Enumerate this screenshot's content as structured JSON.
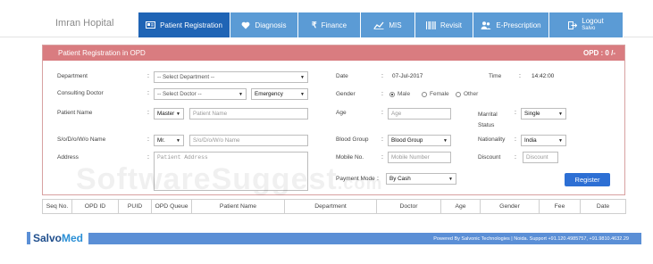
{
  "brand": "Imran Hopital",
  "nav": {
    "items": [
      {
        "label": "Patient Registration",
        "icon": "id-card-icon",
        "active": true
      },
      {
        "label": "Diagnosis",
        "icon": "heart-icon",
        "active": false
      },
      {
        "label": "Finance",
        "icon": "rupee-icon",
        "active": false
      },
      {
        "label": "MIS",
        "icon": "line-chart-icon",
        "active": false
      },
      {
        "label": "Revisit",
        "icon": "barcode-icon",
        "active": false
      },
      {
        "label": "E-Prescription",
        "icon": "users-icon",
        "active": false
      }
    ],
    "logout": {
      "label": "Logout",
      "user": "Salvo"
    }
  },
  "panel": {
    "title": "Patient Registration in OPD",
    "opd": "OPD : 0 /-"
  },
  "form": {
    "department": {
      "label": "Department",
      "value": "-- Select Department --"
    },
    "date": {
      "label": "Date",
      "value": "07-Jul-2017"
    },
    "time": {
      "label": "Time",
      "value": "14:42:00"
    },
    "consulting_doctor": {
      "label": "Consulting Doctor",
      "value": "-- Select Doctor --",
      "type_value": "Emergency"
    },
    "gender": {
      "label": "Gender",
      "options": [
        "Male",
        "Female",
        "Other"
      ],
      "selected": "Male"
    },
    "patient_name": {
      "label": "Patient Name",
      "title": "Master",
      "placeholder": "Patient Name"
    },
    "age": {
      "label": "Age",
      "placeholder": "Age"
    },
    "marital_status": {
      "label": "Marrital Status",
      "value": "Single"
    },
    "relation": {
      "label": "S/o/D/o/W/o Name",
      "title": "Mr.",
      "placeholder": "S/o/D/o/W/o Name"
    },
    "blood_group": {
      "label": "Blood Group",
      "value": "Blood Group"
    },
    "nationality": {
      "label": "Nationality",
      "value": "India"
    },
    "address": {
      "label": "Address",
      "placeholder": "Patient Address"
    },
    "mobile": {
      "label": "Mobile No.",
      "placeholder": "Mobile Number"
    },
    "discount": {
      "label": "Discount",
      "placeholder": "Discount"
    },
    "payment_mode": {
      "label": "Payment Mode",
      "value": "By Cash"
    },
    "register_label": "Register"
  },
  "table": {
    "columns": [
      "Seq No.",
      "OPD ID",
      "PUID",
      "OPD Queue",
      "Patient Name",
      "Department",
      "Doctor",
      "Age",
      "Gender",
      "Fee",
      "Date"
    ]
  },
  "footer": {
    "logo_part1": "Salvo",
    "logo_part2": "Med",
    "text": "Powered By Salvonic Technologies | Noida. Support +91.120.4985757, +91.9810.4632.29"
  },
  "watermark": {
    "main": "SoftwareSuggest",
    "suffix": ".com"
  }
}
